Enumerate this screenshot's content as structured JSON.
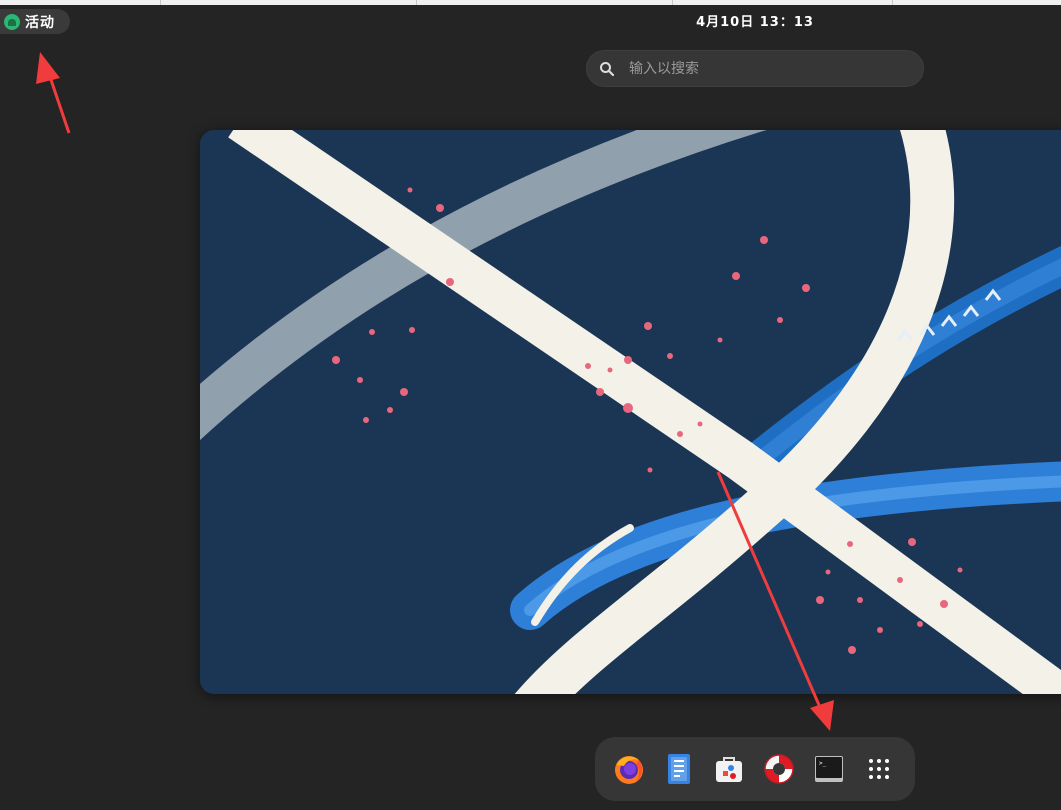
{
  "topbar": {
    "activities_label": "活动",
    "clock": "4月10日  13：13"
  },
  "search": {
    "placeholder": "输入以搜索"
  },
  "dash": {
    "apps": [
      {
        "name": "firefox",
        "icon": "firefox-icon"
      },
      {
        "name": "text-editor",
        "icon": "text-editor-icon"
      },
      {
        "name": "software",
        "icon": "software-store-icon"
      },
      {
        "name": "help",
        "icon": "lifebuoy-icon"
      },
      {
        "name": "terminal",
        "icon": "terminal-icon"
      },
      {
        "name": "show-apps",
        "icon": "app-grid-icon"
      }
    ],
    "terminal_prompt": ">_"
  },
  "colors": {
    "background": "#242424",
    "panel": "#363636",
    "accent_logo": "#2bb673",
    "wallpaper_bg": "#1b3655",
    "wallpaper_stroke": "#f3f1e8",
    "annotation": "#f03c3c"
  }
}
